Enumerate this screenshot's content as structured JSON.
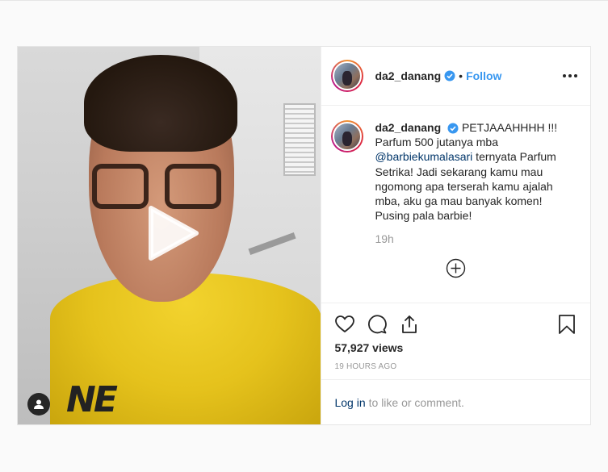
{
  "post": {
    "author": "da2_danang",
    "dot": "•",
    "follow_label": "Follow",
    "caption": {
      "author": "da2_danang",
      "text_before": "PETJAAAHHHH !!! Parfum 500 jutanya mba",
      "mention": "@barbiekumalasari",
      "text_after": " ternyata Parfum Setrika! Jadi sekarang kamu mau ngomong apa terserah kamu ajalah mba, aku ga mau banyak komen! Pusing pala barbie!"
    },
    "caption_time": "19h",
    "views": "57,927 views",
    "posted_ago": "19 HOURS AGO",
    "login_link": "Log in",
    "login_suffix": "to like or comment.",
    "icons": {
      "more": "more-horizontal-icon",
      "play": "play-icon",
      "user_tag": "user-tag-icon",
      "load_more": "plus-circle-icon",
      "like": "heart-icon",
      "comment": "comment-icon",
      "share": "share-icon",
      "save": "bookmark-icon"
    },
    "colors": {
      "link": "#3897f0",
      "mention": "#003569",
      "muted": "#999999",
      "verified": "#3897f0"
    }
  }
}
